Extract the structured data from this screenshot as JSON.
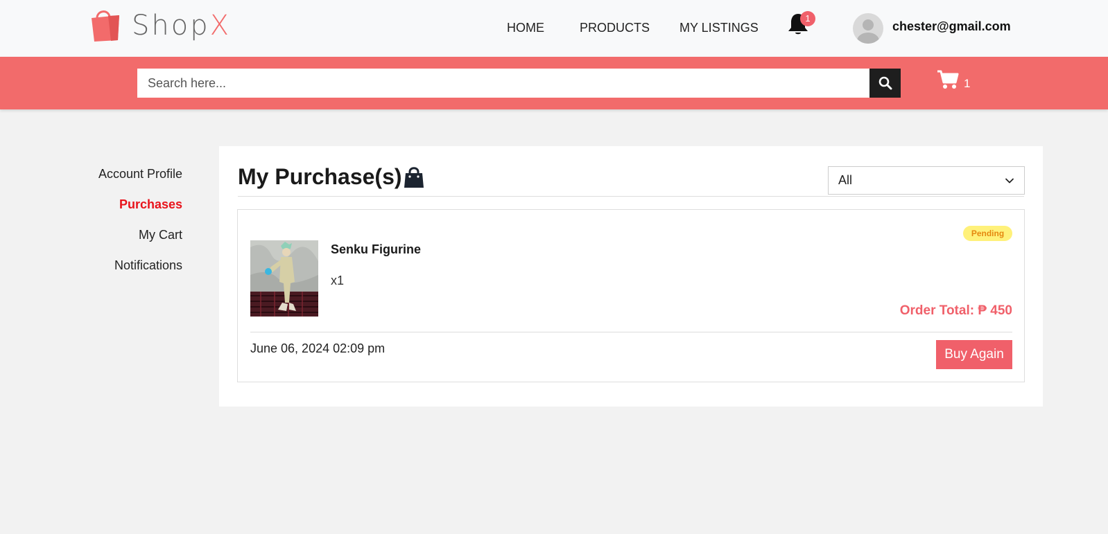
{
  "header": {
    "logo_text_main": "Shop",
    "logo_text_accent": "X",
    "logo_icon": "shopping-bag-icon",
    "nav": [
      "HOME",
      "PRODUCTS",
      "MY LISTINGS"
    ],
    "notification_count": "1",
    "user_email": "chester@gmail.com"
  },
  "search": {
    "placeholder": "Search here...",
    "value": "",
    "button_icon": "search-icon"
  },
  "cart": {
    "count": "1",
    "icon": "cart-icon"
  },
  "sidebar": {
    "items": [
      {
        "label": "Account Profile",
        "active": false
      },
      {
        "label": "Purchases",
        "active": true
      },
      {
        "label": "My Cart",
        "active": false
      },
      {
        "label": "Notifications",
        "active": false
      }
    ]
  },
  "main": {
    "title": "My Purchase(s)",
    "title_icon": "shopping-bag-icon",
    "filter": {
      "selected": "All"
    }
  },
  "orders": [
    {
      "product_name": "Senku Figurine",
      "quantity": "x1",
      "status": "Pending",
      "order_total": "Order Total: ₱ 450",
      "date": "June 06, 2024 02:09 pm",
      "action_label": "Buy Again"
    }
  ],
  "colors": {
    "accent": "#f26b6b",
    "active_link": "#e8141c",
    "pending_bg": "#fff17a",
    "pending_text": "#e5880f",
    "search_button": "#1e1e1e"
  }
}
